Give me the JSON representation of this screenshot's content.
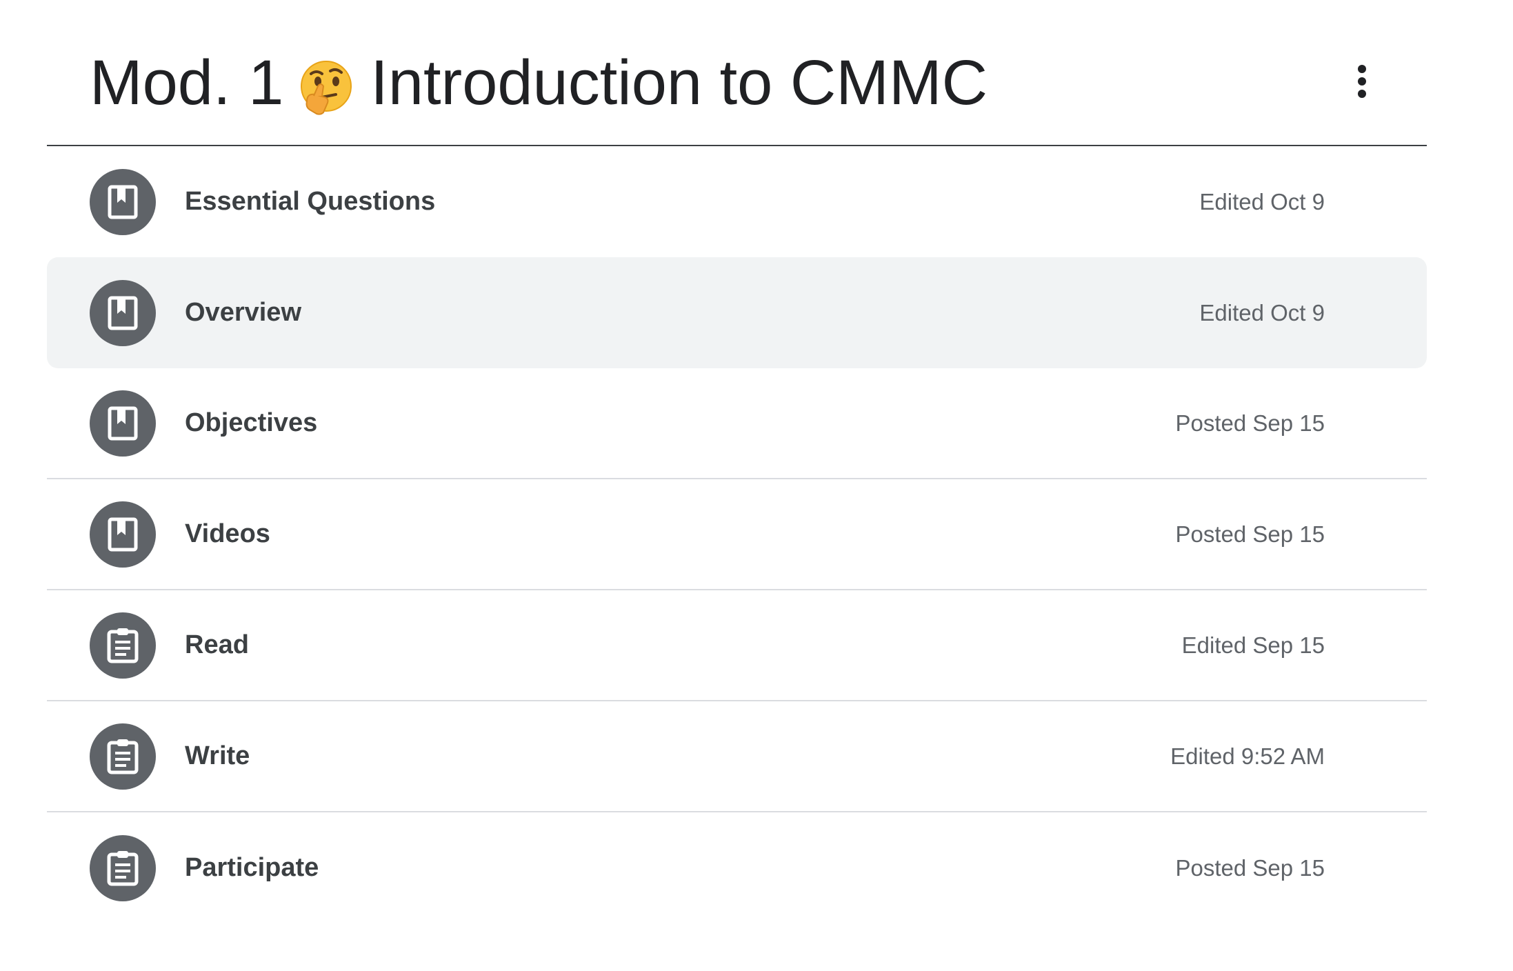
{
  "topic": {
    "title_prefix": "Mod. 1",
    "title_emoji": "thinking-face-emoji",
    "title_text": "Introduction to CMMC",
    "more_icon": "more-vert-icon"
  },
  "materials": [
    {
      "title": "Essential Questions",
      "meta": "Edited Oct 9",
      "icon": "book-icon"
    },
    {
      "title": "Overview",
      "meta": "Edited Oct 9",
      "icon": "book-icon",
      "highlighted": true
    },
    {
      "title": "Objectives",
      "meta": "Posted Sep 15",
      "icon": "book-icon"
    },
    {
      "title": "Videos",
      "meta": "Posted Sep 15",
      "icon": "book-icon"
    },
    {
      "title": "Read",
      "meta": "Edited Sep 15",
      "icon": "assignment-icon"
    },
    {
      "title": "Write",
      "meta": "Edited 9:52 AM",
      "icon": "assignment-icon"
    },
    {
      "title": "Participate",
      "meta": "Posted Sep 15",
      "icon": "assignment-icon"
    }
  ],
  "colors": {
    "icon_circle": "#5f6368",
    "highlight_bg": "#f1f3f4",
    "divider": "#dadce0",
    "header_rule": "#3c4043"
  }
}
